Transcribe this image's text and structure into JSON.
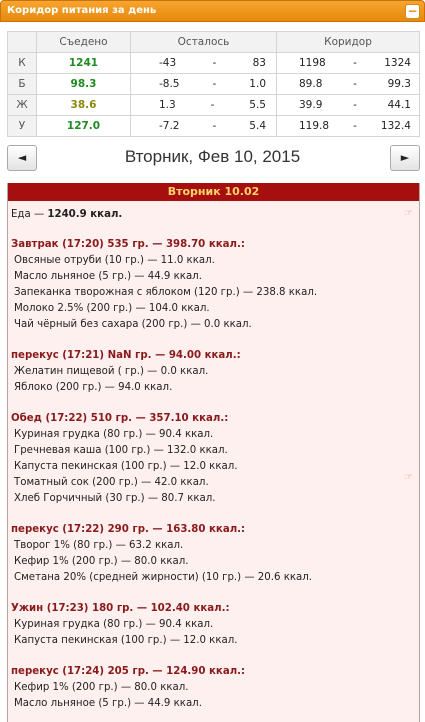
{
  "header": {
    "title": "Коридор питания за день",
    "collapse": "−"
  },
  "corridor": {
    "columns": [
      "Съедено",
      "Осталось",
      "Коридор"
    ],
    "rows": [
      {
        "letter": "К",
        "eaten": "1241",
        "rem_a": "-43",
        "rem_b": "83",
        "cor_a": "1198",
        "cor_b": "1324"
      },
      {
        "letter": "Б",
        "eaten": "98.3",
        "rem_a": "-8.5",
        "rem_b": "1.0",
        "cor_a": "89.8",
        "cor_b": "99.3"
      },
      {
        "letter": "Ж",
        "eaten": "38.6",
        "rem_a": "1.3",
        "rem_b": "5.5",
        "cor_a": "39.9",
        "cor_b": "44.1"
      },
      {
        "letter": "У",
        "eaten": "127.0",
        "rem_a": "-7.2",
        "rem_b": "5.4",
        "cor_a": "119.8",
        "cor_b": "132.4"
      }
    ],
    "dash": "-"
  },
  "nav": {
    "prev": "◄",
    "next": "►",
    "date": "Вторник, Фев 10, 2015"
  },
  "day": {
    "title": "Вторник 10.02",
    "total_label": "Еда",
    "total_value": "1240.9 ккал.",
    "meals": [
      {
        "head": "Завтрак (17:20) 535 гр. — 398.70 ккал.:",
        "items": [
          "Овсяные отруби (10 гр.) — 11.0 ккал.",
          "Масло льняное (5 гр.) — 44.9 ккал.",
          "Запеканка творожная с яблоком (120 гр.) — 238.8 ккал.",
          "Молоко 2.5% (200 гр.) — 104.0 ккал.",
          "Чай чёрный без сахара (200 гр.) — 0.0 ккал."
        ]
      },
      {
        "head": "перекус (17:21) NaN гр. — 94.00 ккал.:",
        "items": [
          "Желатин пищевой ( гр.) — 0.0 ккал.",
          "Яблоко (200 гр.) — 94.0 ккал."
        ]
      },
      {
        "head": "Обед (17:22) 510 гр. — 357.10 ккал.:",
        "items": [
          "Куриная грудка (80 гр.) — 90.4 ккал.",
          "Гречневая каша (100 гр.) — 132.0 ккал.",
          "Капуста пекинская (100 гр.) — 12.0 ккал.",
          "Томатный сок (200 гр.) — 42.0 ккал.",
          "Хлеб Горчичный (30 гр.) — 80.7 ккал."
        ]
      },
      {
        "head": "перекус (17:22) 290 гр. — 163.80 ккал.:",
        "items": [
          "Творог 1% (80 гр.) — 63.2 ккал.",
          "Кефир 1% (200 гр.) — 80.0 ккал.",
          "Сметана 20% (средней жирности) (10 гр.) — 20.6 ккал."
        ]
      },
      {
        "head": "Ужин (17:23) 180 гр. — 102.40 ккал.:",
        "items": [
          "Куриная грудка (80 гр.) — 90.4 ккал.",
          "Капуста пекинская (100 гр.) — 12.0 ккал."
        ]
      },
      {
        "head": "перекус (17:24) 205 гр. — 124.90 ккал.:",
        "items": [
          "Кефир 1% (200 гр.) — 80.0 ккал.",
          "Масло льняное (5 гр.) — 44.9 ккал."
        ]
      }
    ]
  },
  "colors": {
    "header": "#e8890c",
    "day_title_bg": "#a60f0f",
    "day_title_text": "#ffd36a",
    "meal_head": "#8a1a1a"
  },
  "icons": {
    "hand": "hand-pointer-icon"
  }
}
